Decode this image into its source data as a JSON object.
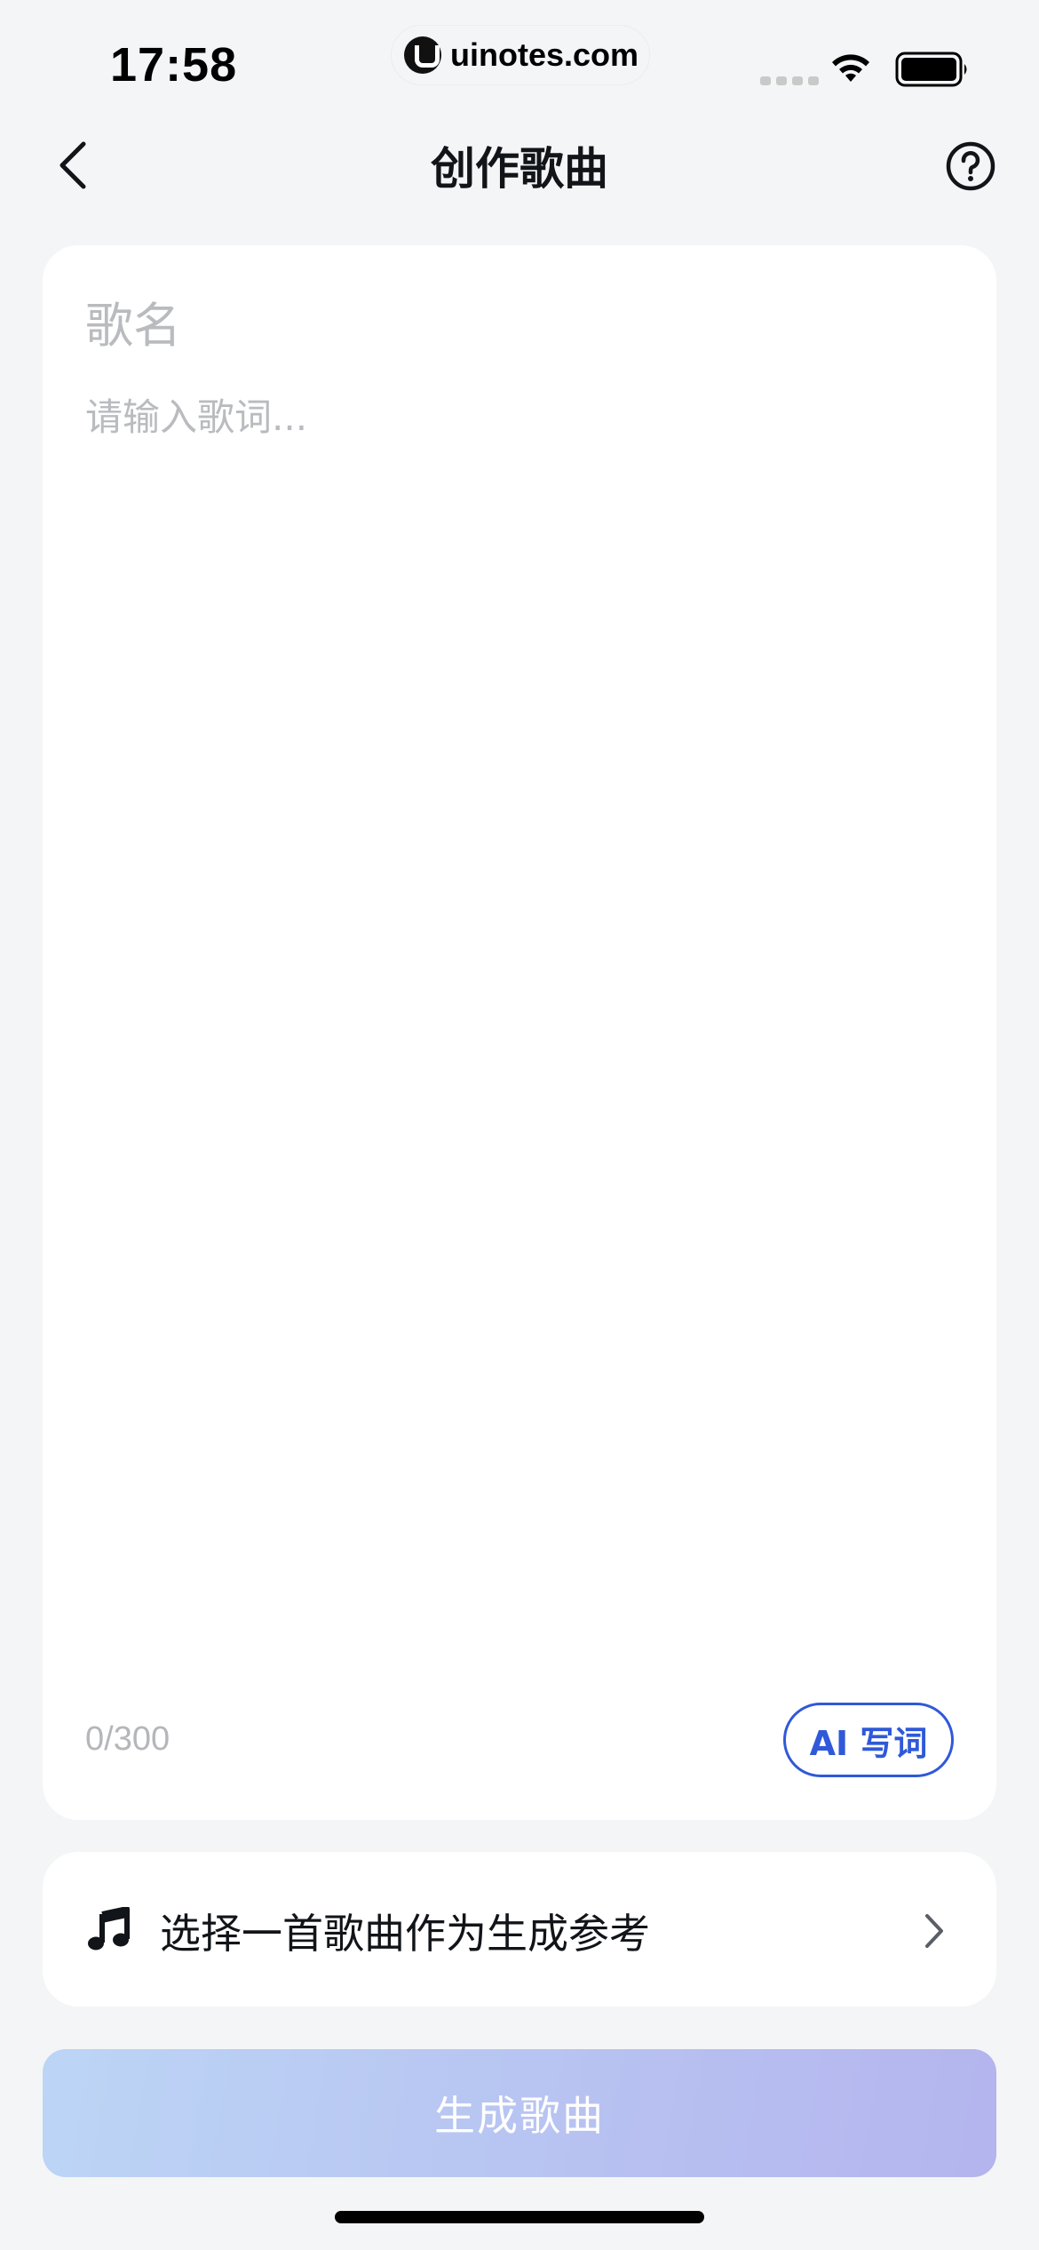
{
  "status_bar": {
    "time": "17:58",
    "url": "uinotes.com",
    "icons": [
      "cellular-signal-icon",
      "wifi-icon",
      "battery-icon"
    ]
  },
  "nav": {
    "title": "创作歌曲",
    "back_icon": "chevron-left-icon",
    "help_icon": "question-circle-icon"
  },
  "editor": {
    "title_placeholder": "歌名",
    "title_value": "",
    "lyrics_placeholder": "请输入歌词...",
    "lyrics_value": "",
    "char_count": "0/300",
    "ai_button_label": "AI 写词"
  },
  "reference": {
    "icon": "music-note-icon",
    "label": "选择一首歌曲作为生成参考",
    "chevron_icon": "chevron-right-icon"
  },
  "generate_button": {
    "label": "生成歌曲",
    "enabled": false
  },
  "colors": {
    "accent": "#2f59d8",
    "background": "#f4f5f6",
    "placeholder": "#b9bbbf",
    "button_gradient_start": "#bcd5f5",
    "button_gradient_end": "#b4b4ee"
  }
}
